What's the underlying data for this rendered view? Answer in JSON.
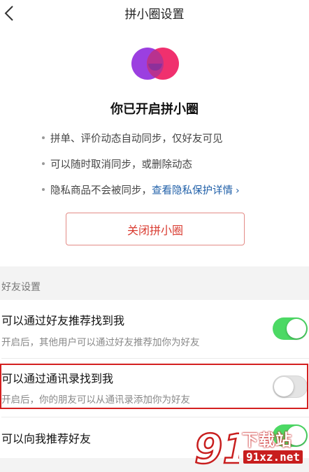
{
  "header": {
    "title": "拼小圈设置"
  },
  "intro": {
    "title": "你已开启拼小圈",
    "bullets": [
      {
        "text": "拼单、评价动态自动同步，仅好友可见"
      },
      {
        "text": "可以随时取消同步，或删除动态"
      },
      {
        "text": "隐私商品不会被同步，",
        "link": "查看隐私保护详情"
      }
    ],
    "close_button": "关闭拼小圈"
  },
  "friend_settings": {
    "section_label": "好友设置",
    "rows": [
      {
        "title": "可以通过好友推荐找到我",
        "desc": "开启后，其他用户可以通过好友推荐加你为好友",
        "enabled": true
      },
      {
        "title": "可以通过通讯录找到我",
        "desc": "开启后，你的朋友可以从通讯录添加你为好友",
        "enabled": false
      },
      {
        "title": "可以向我推荐好友",
        "enabled": true
      }
    ]
  },
  "watermark": {
    "site": "下载站",
    "domain": "91xz.net"
  },
  "colors": {
    "logo_purple": "#9b3fe0",
    "logo_pink": "#f0306e",
    "toggle_on": "#4cd964",
    "link": "#1f5fa8",
    "danger": "#d93b30",
    "highlight_border": "#d42020"
  },
  "icons": {
    "back": "chevron-left-icon",
    "link_arrow": "chevron-right-icon",
    "logo": "overlapping-circles-logo"
  }
}
